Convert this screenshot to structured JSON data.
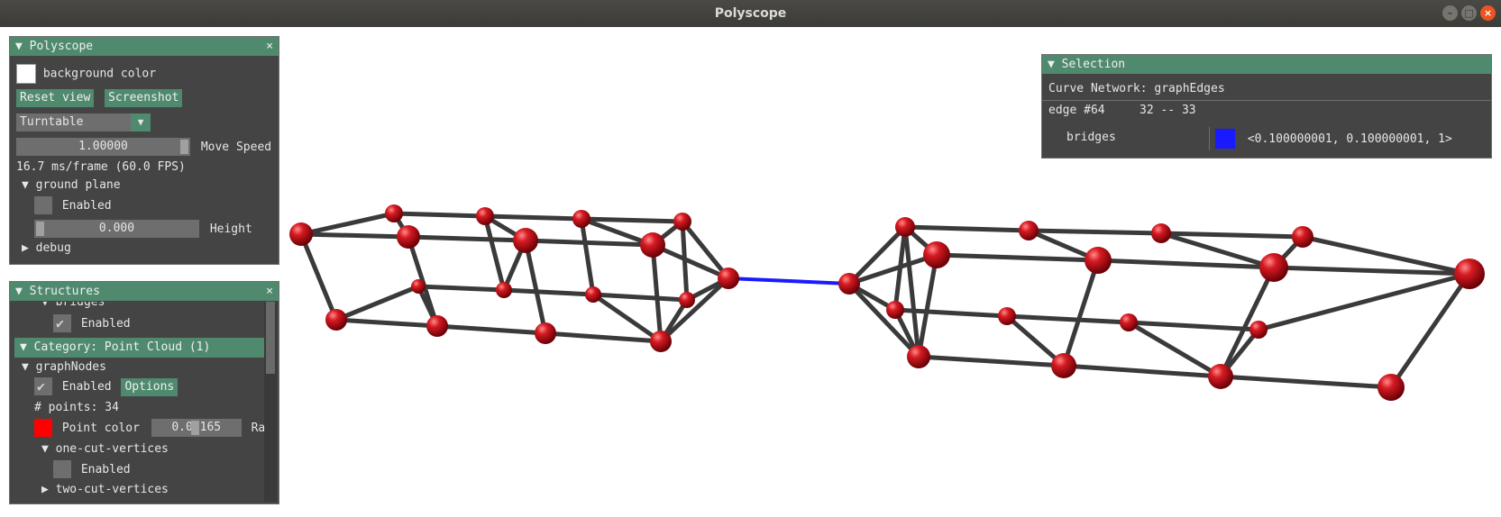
{
  "window": {
    "title": "Polyscope"
  },
  "polyscope_panel": {
    "title": "Polyscope",
    "close": "×",
    "background_color_label": "background color",
    "background_color": "#ffffff",
    "reset_view": "Reset view",
    "screenshot": "Screenshot",
    "view_mode": "Turntable",
    "move_speed_value": "1.00000",
    "move_speed_label": "Move Speed",
    "fps_text": "16.7 ms/frame (60.0 FPS)",
    "ground_plane": "ground plane",
    "enabled_label": "Enabled",
    "height_value": "0.000",
    "height_label": "Height",
    "debug": "debug"
  },
  "structures_panel": {
    "title": "Structures",
    "close": "×",
    "bridges_label": "bridges",
    "enabled_label": "Enabled",
    "category": "Category: Point Cloud (1)",
    "graph_nodes": "graphNodes",
    "options": "Options",
    "num_points": "# points: 34",
    "point_color_label": "Point color",
    "point_color": "#ff0000",
    "radius_value": "0.01165",
    "radius_label": "Rad",
    "one_cut": "one-cut-vertices",
    "two_cut": "two-cut-vertices"
  },
  "selection_panel": {
    "title": "Selection",
    "structure": "Curve Network: graphEdges",
    "edge_id": "edge #64",
    "edge_nodes": "32 -- 33",
    "quantity": "bridges",
    "quantity_color": "#1a1aff",
    "quantity_value": "<0.100000001, 0.100000001, 1>"
  },
  "colors": {
    "node": "#c8101a",
    "edge": "#3a3a3a",
    "bridge": "#1a1aff",
    "panel_header": "#4f8a6e"
  }
}
